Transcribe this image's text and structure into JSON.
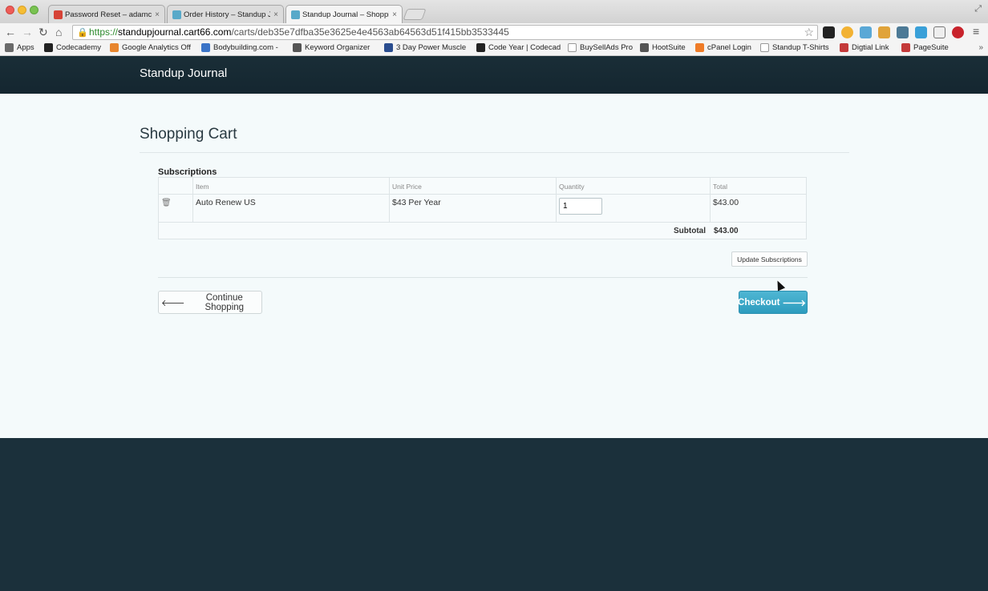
{
  "browser": {
    "tabs": [
      {
        "title": "Password Reset – adamch",
        "icon_color": "#d64236",
        "close": "×"
      },
      {
        "title": "Order History – Standup Jo",
        "icon_color": "#58a9c9",
        "close": "×"
      },
      {
        "title": "Standup Journal – Shoppin",
        "icon_color": "#58a9c9",
        "close": "×"
      }
    ],
    "address": {
      "scheme": "https://",
      "host": "standupjournal.cart66.com",
      "path": "/carts/deb35e7dfba35e3625e4e4563ab64563d51f415bb3533445"
    },
    "bookmarks": [
      "Apps",
      "Codecademy",
      "Google Analytics Off",
      "Bodybuilding.com -",
      "Keyword Organizer",
      "3 Day Power Muscle",
      "Code Year | Codecad",
      "BuySellAds Pro",
      "HootSuite",
      "cPanel Login",
      "Standup T-Shirts",
      "Digtial Link",
      "PageSuite"
    ],
    "bookmarks_more": "»"
  },
  "site": {
    "brand": "Standup Journal"
  },
  "cart": {
    "title": "Shopping Cart",
    "section": "Subscriptions",
    "columns": [
      "Item",
      "Unit Price",
      "Quantity",
      "Total"
    ],
    "items": [
      {
        "name": "Auto Renew US",
        "unit_price": "$43 Per Year",
        "quantity": "1",
        "total": "$43.00"
      }
    ],
    "subtotal_label": "Subtotal",
    "subtotal_value": "$43.00",
    "update_label": "Update Subscriptions",
    "continue_label": "Continue Shopping",
    "checkout_label": "Checkout"
  }
}
